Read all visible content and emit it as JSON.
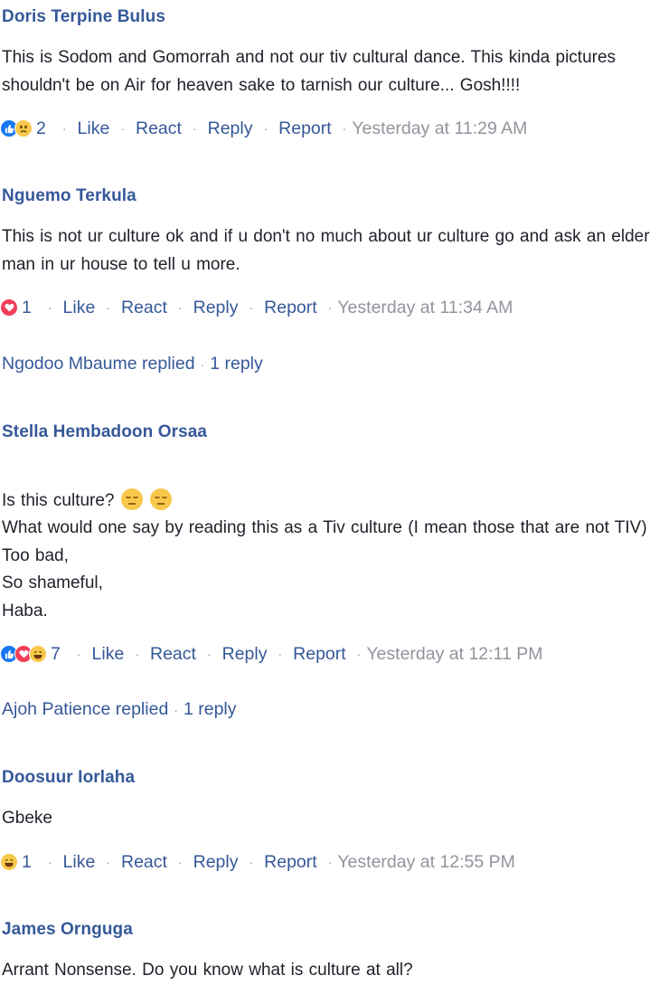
{
  "comments": [
    {
      "author": "Doris Terpine Bulus",
      "text": "This is Sodom and Gomorrah and not our tiv cultural dance. This kinda pictures shouldn't be on Air for heaven sake to tarnish our culture... Gosh!!!!",
      "reactions": [
        "like",
        "sad"
      ],
      "reaction_count": "2",
      "time": "Yesterday at 11:29 AM"
    },
    {
      "author": "Nguemo Terkula",
      "text": "This is not ur culture ok and if u don't no much about ur culture go and ask an elder man in ur house to tell u more.",
      "reactions": [
        "love"
      ],
      "reaction_count": "1",
      "time": "Yesterday at 11:34 AM",
      "replies": {
        "who": "Ngodoo Mbaume replied",
        "count": "1 reply"
      }
    },
    {
      "author": "Stella Hembadoon Orsaa",
      "line1": "Is this culture?",
      "text": "What would one say by reading this as a Tiv culture (I mean those that are not TIV)\nToo bad,\nSo shameful,\nHaba.",
      "reactions": [
        "like",
        "love",
        "haha"
      ],
      "reaction_count": "7",
      "time": "Yesterday at 12:11 PM",
      "replies": {
        "who": "Ajoh Patience replied",
        "count": "1 reply"
      }
    },
    {
      "author": "Doosuur Iorlaha",
      "text": "Gbeke",
      "reactions": [
        "haha"
      ],
      "reaction_count": "1",
      "time": "Yesterday at 12:55 PM"
    },
    {
      "author": "James Ornguga",
      "text": "Arrant Nonsense. Do you know what is culture at all?"
    }
  ],
  "action_labels": {
    "like": "Like",
    "react": "React",
    "reply": "Reply",
    "report": "Report",
    "separator": "·"
  },
  "colors": {
    "link": "#365899",
    "muted": "#90949c",
    "text": "#1d2129",
    "like": "#1877f2",
    "love": "#f33e58",
    "emoji": "#f7c84b"
  }
}
